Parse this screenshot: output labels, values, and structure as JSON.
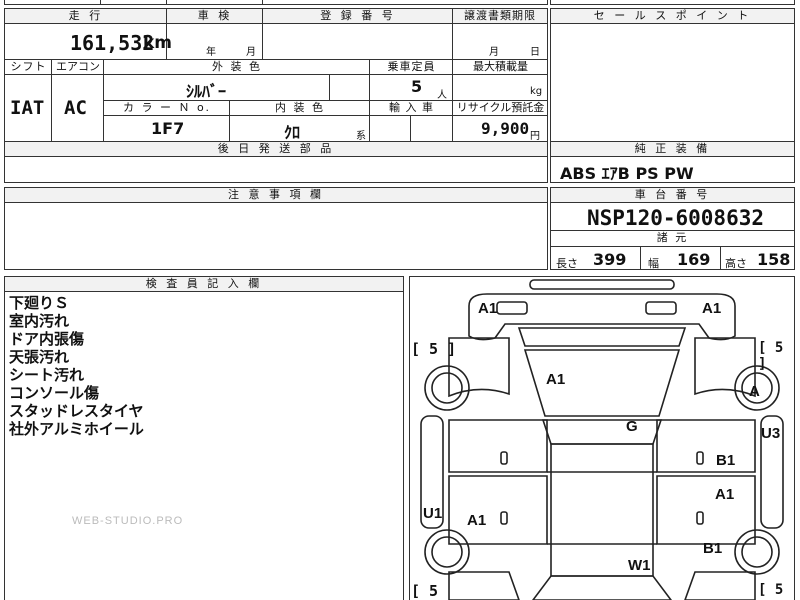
{
  "top_partial": {
    "text1": "国",
    "text2": "検"
  },
  "mileage": {
    "header": "走 行",
    "value": "161,532",
    "unit": "km"
  },
  "inspection": {
    "header": "車 検",
    "year_unit": "年",
    "month_unit": "月"
  },
  "registration": {
    "header": "登 録 番 号"
  },
  "transfer": {
    "header": "譲渡書類期限",
    "month_unit": "月",
    "day_unit": "日"
  },
  "sales_points": {
    "header": "セ ー ル ス ポ イ ン ト"
  },
  "shift": {
    "header": "シフト",
    "value": "IAT"
  },
  "aircon": {
    "header": "エアコン",
    "value": "AC"
  },
  "exterior": {
    "header": "外 装 色",
    "value": "ｼﾙﾊﾞｰ"
  },
  "capacity": {
    "header": "乗車定員",
    "value": "5",
    "unit": "人"
  },
  "max_load": {
    "header": "最大積載量",
    "unit": "kg"
  },
  "color_no": {
    "header": "カ ラ ー Ｎ o.",
    "value": "1F7"
  },
  "interior": {
    "header": "内 装 色",
    "value": "ｸﾛ",
    "suffix": "系"
  },
  "import_car": {
    "header": "輸 入 車"
  },
  "recycle": {
    "header": "リサイクル預託金",
    "value": "9,900",
    "unit": "円"
  },
  "later_parts": {
    "header": "後 日 発 送 部 品"
  },
  "equipment": {
    "header": "純 正 装 備",
    "value": "ABS ｴｱB PS PW"
  },
  "caution": {
    "header": "注 意 事 項 欄"
  },
  "chassis": {
    "header": "車 台 番 号",
    "value": "NSP120-6008632"
  },
  "specs": {
    "header": "諸 元",
    "length_label": "長さ",
    "length": "399",
    "width_label": "幅",
    "width": "169",
    "height_label": "高さ",
    "height": "158"
  },
  "inspector": {
    "header": "検 査 員 記 入 欄",
    "notes": [
      "下廻りＳ",
      "室内汚れ",
      "ドア内張傷",
      "天張汚れ",
      "シート汚れ",
      "コンソール傷",
      "スタッドレスタイヤ",
      "社外アルミホイール"
    ],
    "watermark": "WEB-STUDIO.PRO"
  },
  "diagram": {
    "marks": {
      "a1_top_left": "A1",
      "a1_top_right": "A1",
      "tire_fl": "[ 5 ]",
      "tire_fr": "[ 5 ]",
      "a1_roof": "A1",
      "a_wheel": "A",
      "g_center": "G",
      "u3": "U3",
      "b1_right_front": "B1",
      "a1_right_rear": "A1",
      "u1": "U1",
      "a1_left_rear": "A1",
      "b1_right_bottom": "B1",
      "w1": "W1",
      "tire_rl": "[ 5",
      "tire_rr": "[ 5"
    }
  }
}
